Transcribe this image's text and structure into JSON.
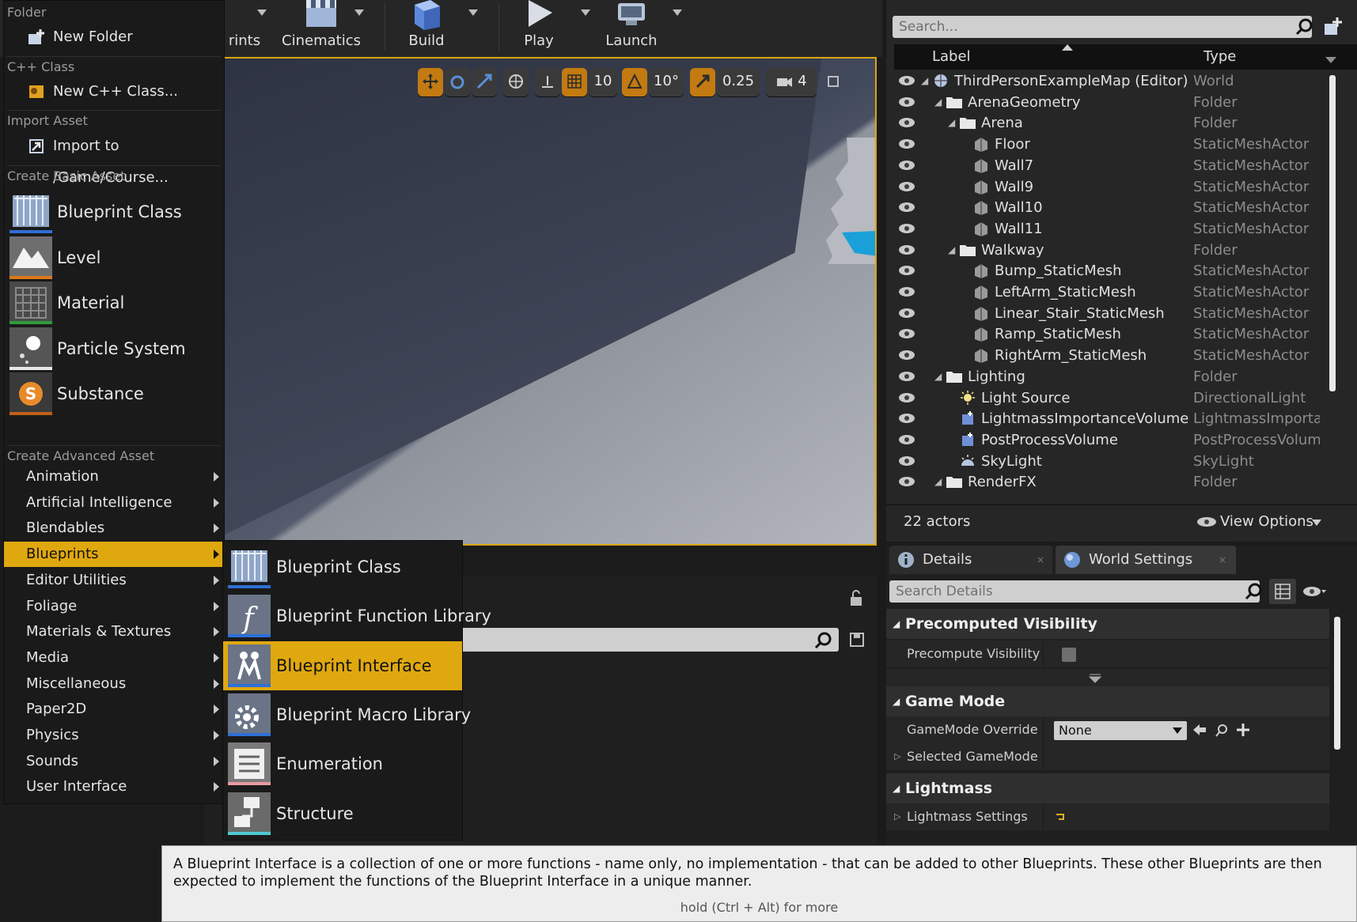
{
  "toolbar": {
    "buttons": [
      {
        "label": "rints"
      },
      {
        "label": "Cinematics"
      },
      {
        "label": "Build"
      },
      {
        "label": "Play"
      },
      {
        "label": "Launch"
      }
    ]
  },
  "viewport_tools": {
    "grid_snap": "10",
    "rotation_snap": "10°",
    "scale_snap": "0.25",
    "camera_speed": "4"
  },
  "menu": {
    "sections": {
      "folder": "Folder",
      "cpp": "C++ Class",
      "import": "Import Asset",
      "basic": "Create Basic Asset",
      "advanced": "Create Advanced Asset"
    },
    "new_folder": "New Folder",
    "new_cpp": "New C++ Class...",
    "import_to": "Import to /Game/Course...",
    "basic_items": [
      {
        "label": "Blueprint Class",
        "icon": "blueprint-class-icon",
        "strip": "#2f6fd6"
      },
      {
        "label": "Level",
        "icon": "level-icon",
        "strip": "#d97a1a"
      },
      {
        "label": "Material",
        "icon": "material-icon",
        "strip": "#2f9a3c"
      },
      {
        "label": "Particle System",
        "icon": "particle-system-icon",
        "strip": "#e8e8e8"
      },
      {
        "label": "Substance",
        "icon": "substance-icon",
        "strip": "#c2601a"
      }
    ],
    "advanced_items": [
      {
        "label": "Animation"
      },
      {
        "label": "Artificial Intelligence"
      },
      {
        "label": "Blendables"
      },
      {
        "label": "Blueprints"
      },
      {
        "label": "Editor Utilities"
      },
      {
        "label": "Foliage"
      },
      {
        "label": "Materials & Textures"
      },
      {
        "label": "Media"
      },
      {
        "label": "Miscellaneous"
      },
      {
        "label": "Paper2D"
      },
      {
        "label": "Physics"
      },
      {
        "label": "Sounds"
      },
      {
        "label": "User Interface"
      }
    ],
    "selected_advanced": "Blueprints"
  },
  "submenu": {
    "items": [
      {
        "label": "Blueprint Class",
        "icon": "blueprint-class-icon",
        "strip": "#2f6fd6"
      },
      {
        "label": "Blueprint Function Library",
        "icon": "blueprint-function-library-icon",
        "strip": "#2f6fd6"
      },
      {
        "label": "Blueprint Interface",
        "icon": "blueprint-interface-icon",
        "strip": "#2f6fd6"
      },
      {
        "label": "Blueprint Macro Library",
        "icon": "blueprint-macro-library-icon",
        "strip": "#2f6fd6"
      },
      {
        "label": "Enumeration",
        "icon": "enumeration-icon",
        "strip": "#e89aa0"
      },
      {
        "label": "Structure",
        "icon": "structure-icon",
        "strip": "#4fc7d0"
      }
    ],
    "selected": "Blueprint Interface"
  },
  "outliner": {
    "search_placeholder": "Search...",
    "col_label": "Label",
    "col_type": "Type",
    "rows": [
      {
        "name": "ThirdPersonExampleMap (Editor)",
        "type": "World",
        "icon": "world-icon"
      },
      {
        "name": "ArenaGeometry",
        "type": "Folder",
        "icon": "folder-icon"
      },
      {
        "name": "Arena",
        "type": "Folder",
        "icon": "folder-icon"
      },
      {
        "name": "Floor",
        "type": "StaticMeshActor",
        "icon": "static-mesh-icon"
      },
      {
        "name": "Wall7",
        "type": "StaticMeshActor",
        "icon": "static-mesh-icon"
      },
      {
        "name": "Wall9",
        "type": "StaticMeshActor",
        "icon": "static-mesh-icon"
      },
      {
        "name": "Wall10",
        "type": "StaticMeshActor",
        "icon": "static-mesh-icon"
      },
      {
        "name": "Wall11",
        "type": "StaticMeshActor",
        "icon": "static-mesh-icon"
      },
      {
        "name": "Walkway",
        "type": "Folder",
        "icon": "folder-icon"
      },
      {
        "name": "Bump_StaticMesh",
        "type": "StaticMeshActor",
        "icon": "static-mesh-icon"
      },
      {
        "name": "LeftArm_StaticMesh",
        "type": "StaticMeshActor",
        "icon": "static-mesh-icon"
      },
      {
        "name": "Linear_Stair_StaticMesh",
        "type": "StaticMeshActor",
        "icon": "static-mesh-icon"
      },
      {
        "name": "Ramp_StaticMesh",
        "type": "StaticMeshActor",
        "icon": "static-mesh-icon"
      },
      {
        "name": "RightArm_StaticMesh",
        "type": "StaticMeshActor",
        "icon": "static-mesh-icon"
      },
      {
        "name": "Lighting",
        "type": "Folder",
        "icon": "folder-icon"
      },
      {
        "name": "Light Source",
        "type": "DirectionalLight",
        "icon": "light-icon"
      },
      {
        "name": "LightmassImportanceVolume",
        "type": "LightmassImportai",
        "icon": "volume-icon"
      },
      {
        "name": "PostProcessVolume",
        "type": "PostProcessVolum",
        "icon": "volume-icon"
      },
      {
        "name": "SkyLight",
        "type": "SkyLight",
        "icon": "skylight-icon"
      },
      {
        "name": "RenderFX",
        "type": "Folder",
        "icon": "folder-icon"
      }
    ],
    "actor_count": "22 actors",
    "view_options": "View Options"
  },
  "details": {
    "tab_details": "Details",
    "tab_world": "World Settings",
    "search_placeholder": "Search Details",
    "sec_visibility": "Precomputed Visibility",
    "prop_precompute": "Precompute Visibility",
    "sec_gamemode": "Game Mode",
    "prop_override": "GameMode Override",
    "override_value": "None",
    "prop_selected": "Selected GameMode",
    "sec_lightmass": "Lightmass",
    "prop_lightmass": "Lightmass Settings"
  },
  "tooltip": {
    "text": "A Blueprint Interface is a collection of one or more functions - name only, no implementation - that can be added to other Blueprints. These other Blueprints are then expected to implement the functions of the Blueprint Interface in a unique manner.",
    "hint": "hold (Ctrl + Alt) for more"
  }
}
